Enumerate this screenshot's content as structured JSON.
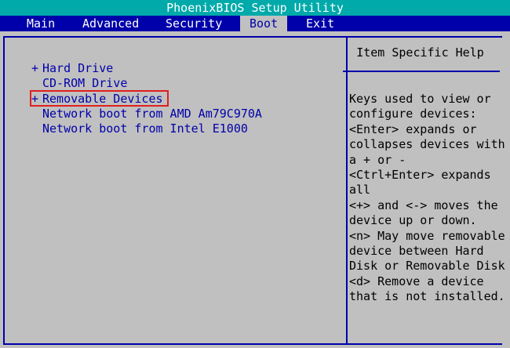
{
  "title": "PhoenixBIOS Setup Utility",
  "menu": [
    {
      "label": "Main"
    },
    {
      "label": "Advanced"
    },
    {
      "label": "Security"
    },
    {
      "label": "Boot"
    },
    {
      "label": "Exit"
    }
  ],
  "active_menu": "Boot",
  "boot_items": [
    {
      "marker": "+",
      "label": "Hard Drive"
    },
    {
      "marker": "",
      "label": "CD-ROM Drive"
    },
    {
      "marker": "+",
      "label": "Removable Devices"
    },
    {
      "marker": "",
      "label": "Network boot from AMD Am79C970A"
    },
    {
      "marker": "",
      "label": "Network boot from Intel E1000"
    }
  ],
  "help": {
    "title": "Item Specific Help",
    "lines": [
      "Keys used to view or",
      "configure devices:",
      "<Enter> expands or",
      "collapses devices with",
      "a + or -",
      "<Ctrl+Enter> expands",
      "all",
      "<+> and <-> moves the",
      "device up or down.",
      "<n> May move removable",
      "device between Hard",
      "Disk or Removable Disk",
      "<d> Remove a device",
      "that is not installed."
    ]
  },
  "colors": {
    "title_bg": "#00aaaa",
    "menu_bg": "#0000aa",
    "panel_bg": "#c0c0c0",
    "item_text": "#0000aa",
    "highlight_box": "#e02020"
  }
}
